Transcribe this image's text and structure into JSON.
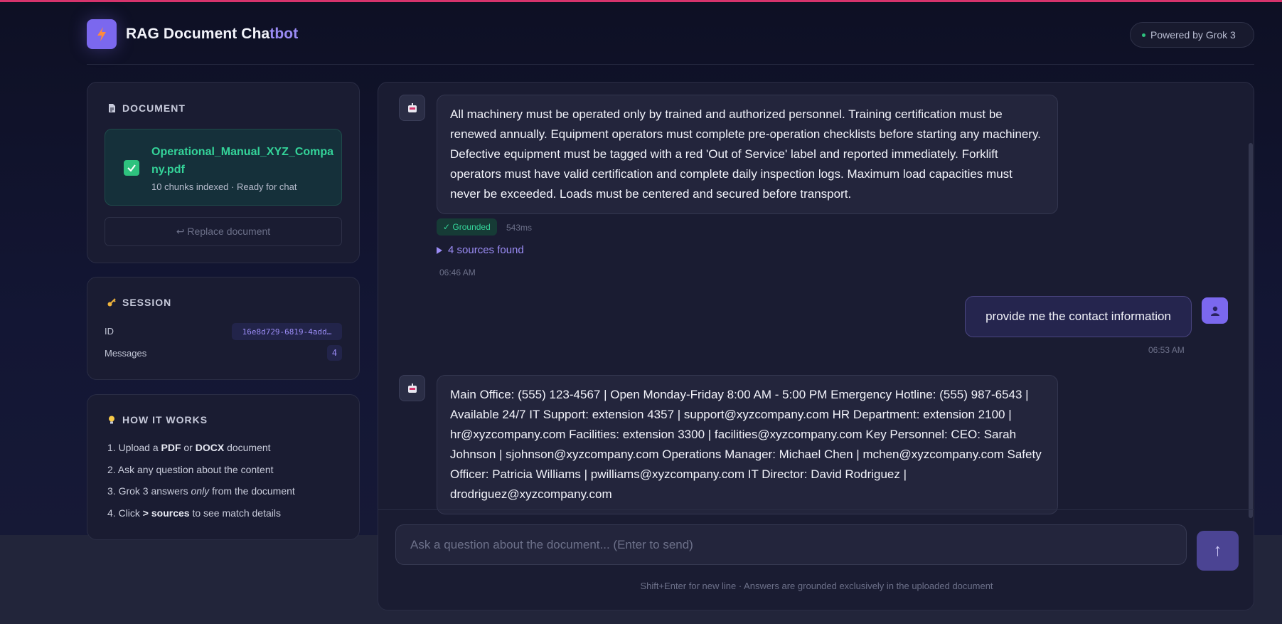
{
  "header": {
    "title_main": "RAG Document Cha",
    "title_accent": "tbot",
    "powered_by": "Powered by Grok 3"
  },
  "document_card": {
    "title": "DOCUMENT",
    "file_name": "Operational_Manual_XYZ_Company.pdf",
    "file_status": "10 chunks indexed · Ready for chat",
    "replace_label": "↩ Replace document"
  },
  "session_card": {
    "title": "SESSION",
    "id_label": "ID",
    "id_value": "16e8d729-6819-4add…",
    "messages_label": "Messages",
    "messages_count": "4"
  },
  "how_card": {
    "title": "HOW IT WORKS",
    "steps": [
      {
        "pre": "1. Upload a ",
        "b1": "PDF",
        "mid": " or ",
        "b2": "DOCX",
        "post": " document"
      },
      {
        "text": "2. Ask any question about the content"
      },
      {
        "pre": "3. Grok 3 answers ",
        "em": "only",
        "post": " from the document"
      },
      {
        "pre": "4. Click ",
        "b1": "> sources",
        "post": " to see match details"
      }
    ]
  },
  "chat": {
    "messages": [
      {
        "role": "assistant",
        "text": "All machinery must be operated only by trained and authorized personnel. Training certification must be renewed annually. Equipment operators must complete pre-operation checklists before starting any machinery. Defective equipment must be tagged with a red 'Out of Service' label and reported immediately. Forklift operators must have valid certification and complete daily inspection logs. Maximum load capacities must never be exceeded. Loads must be centered and secured before transport.",
        "badge": "✓ Grounded",
        "latency": "543ms",
        "sources": "4 sources found",
        "time": "06:46 AM"
      },
      {
        "role": "user",
        "text": "provide me the contact information",
        "time": "06:53 AM"
      },
      {
        "role": "assistant",
        "text": "Main Office: (555) 123-4567 | Open Monday-Friday 8:00 AM - 5:00 PM Emergency Hotline: (555) 987-6543 | Available 24/7 IT Support: extension 4357 | support@xyzcompany.com HR Department: extension 2100 | hr@xyzcompany.com Facilities: extension 3300 | facilities@xyzcompany.com Key Personnel: CEO: Sarah Johnson | sjohnson@xyzcompany.com Operations Manager: Michael Chen | mchen@xyzcompany.com Safety Officer: Patricia Williams | pwilliams@xyzcompany.com IT Director: David Rodriguez | drodriguez@xyzcompany.com"
      }
    ],
    "input_placeholder": "Ask a question about the document... (Enter to send)",
    "send_icon": "↑",
    "hint": "Shift+Enter for new line · Answers are grounded exclusively in the uploaded document"
  },
  "colors": {
    "accent": "#7b68ee",
    "success": "#34d399",
    "top_border": "#d6336c"
  }
}
